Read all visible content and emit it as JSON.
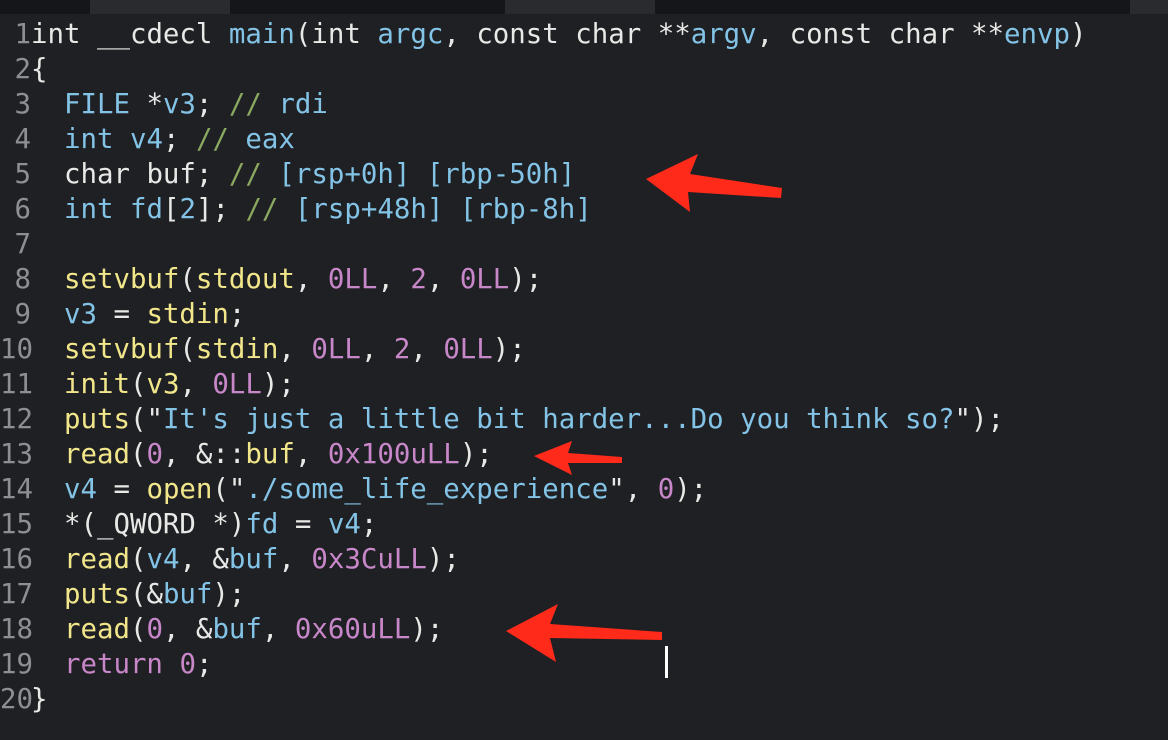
{
  "editor": {
    "lines": [
      {
        "num": "1",
        "tokens": [
          [
            "t-ty",
            "int"
          ],
          [
            "t-kw",
            " __cdecl "
          ],
          [
            "t-id",
            "main"
          ],
          [
            "t-kw",
            "("
          ],
          [
            "t-ty",
            "int"
          ],
          [
            "t-kw",
            " "
          ],
          [
            "t-id",
            "argc"
          ],
          [
            "t-kw",
            ", "
          ],
          [
            "t-ty",
            "const char"
          ],
          [
            "t-kw",
            " **"
          ],
          [
            "t-id",
            "argv"
          ],
          [
            "t-kw",
            ", "
          ],
          [
            "t-ty",
            "const char"
          ],
          [
            "t-kw",
            " **"
          ],
          [
            "t-id",
            "envp"
          ],
          [
            "t-kw",
            ")"
          ]
        ]
      },
      {
        "num": "2",
        "tokens": [
          [
            "t-kw",
            "{"
          ]
        ]
      },
      {
        "num": "3",
        "tokens": [
          [
            "t-kw",
            "  "
          ],
          [
            "t-id",
            "FILE"
          ],
          [
            "t-kw",
            " *"
          ],
          [
            "t-id",
            "v3"
          ],
          [
            "t-kw",
            "; "
          ],
          [
            "t-cm",
            "// "
          ],
          [
            "t-cmtxt",
            "rdi"
          ]
        ]
      },
      {
        "num": "4",
        "tokens": [
          [
            "t-kw",
            "  "
          ],
          [
            "t-id",
            "int"
          ],
          [
            "t-kw",
            " "
          ],
          [
            "t-id",
            "v4"
          ],
          [
            "t-kw",
            "; "
          ],
          [
            "t-cm",
            "// "
          ],
          [
            "t-cmtxt",
            "eax"
          ]
        ]
      },
      {
        "num": "5",
        "tokens": [
          [
            "t-kw",
            "  "
          ],
          [
            "t-kw",
            "char"
          ],
          [
            "t-kw",
            " buf; "
          ],
          [
            "t-cm",
            "// "
          ],
          [
            "t-cmtxt",
            "[rsp+0h] [rbp-50h]"
          ]
        ]
      },
      {
        "num": "6",
        "tokens": [
          [
            "t-kw",
            "  "
          ],
          [
            "t-id",
            "int"
          ],
          [
            "t-kw",
            " "
          ],
          [
            "t-id",
            "fd"
          ],
          [
            "t-kw",
            "["
          ],
          [
            "t-id",
            "2"
          ],
          [
            "t-kw",
            "]; "
          ],
          [
            "t-cm",
            "// "
          ],
          [
            "t-cmtxt",
            "[rsp+48h] [rbp-8h]"
          ]
        ]
      },
      {
        "num": "7",
        "tokens": []
      },
      {
        "num": "8",
        "tokens": [
          [
            "t-kw",
            "  "
          ],
          [
            "t-fn",
            "setvbuf"
          ],
          [
            "t-kw",
            "("
          ],
          [
            "t-fn",
            "stdout"
          ],
          [
            "t-kw",
            ", "
          ],
          [
            "t-num",
            "0LL"
          ],
          [
            "t-kw",
            ", "
          ],
          [
            "t-num",
            "2"
          ],
          [
            "t-kw",
            ", "
          ],
          [
            "t-num",
            "0LL"
          ],
          [
            "t-kw",
            ");"
          ]
        ]
      },
      {
        "num": "9",
        "tokens": [
          [
            "t-kw",
            "  "
          ],
          [
            "t-id",
            "v3"
          ],
          [
            "t-kw",
            " = "
          ],
          [
            "t-fn",
            "stdin"
          ],
          [
            "t-kw",
            ";"
          ]
        ]
      },
      {
        "num": "10",
        "tokens": [
          [
            "t-kw",
            "  "
          ],
          [
            "t-fn",
            "setvbuf"
          ],
          [
            "t-kw",
            "("
          ],
          [
            "t-fn",
            "stdin"
          ],
          [
            "t-kw",
            ", "
          ],
          [
            "t-num",
            "0LL"
          ],
          [
            "t-kw",
            ", "
          ],
          [
            "t-num",
            "2"
          ],
          [
            "t-kw",
            ", "
          ],
          [
            "t-num",
            "0LL"
          ],
          [
            "t-kw",
            ");"
          ]
        ]
      },
      {
        "num": "11",
        "tokens": [
          [
            "t-kw",
            "  "
          ],
          [
            "t-fn",
            "init"
          ],
          [
            "t-kw",
            "("
          ],
          [
            "t-fn",
            "v3"
          ],
          [
            "t-kw",
            ", "
          ],
          [
            "t-num",
            "0LL"
          ],
          [
            "t-kw",
            ");"
          ]
        ]
      },
      {
        "num": "12",
        "tokens": [
          [
            "t-kw",
            "  "
          ],
          [
            "t-fn",
            "puts"
          ],
          [
            "t-kw",
            "(\""
          ],
          [
            "t-str",
            "It's just a little bit harder...Do you think so?"
          ],
          [
            "t-kw",
            "\");"
          ]
        ]
      },
      {
        "num": "13",
        "tokens": [
          [
            "t-kw",
            "  "
          ],
          [
            "t-fn",
            "read"
          ],
          [
            "t-kw",
            "("
          ],
          [
            "t-num",
            "0"
          ],
          [
            "t-kw",
            ", &::"
          ],
          [
            "t-fn",
            "buf"
          ],
          [
            "t-kw",
            ", "
          ],
          [
            "t-num",
            "0x100uLL"
          ],
          [
            "t-kw",
            ");"
          ]
        ]
      },
      {
        "num": "14",
        "tokens": [
          [
            "t-kw",
            "  "
          ],
          [
            "t-id",
            "v4"
          ],
          [
            "t-kw",
            " = "
          ],
          [
            "t-fn",
            "open"
          ],
          [
            "t-kw",
            "(\""
          ],
          [
            "t-str",
            "./some_life_experience"
          ],
          [
            "t-kw",
            "\", "
          ],
          [
            "t-num",
            "0"
          ],
          [
            "t-kw",
            ");"
          ]
        ]
      },
      {
        "num": "15",
        "tokens": [
          [
            "t-kw",
            "  *("
          ],
          [
            "t-kw",
            "_QWORD"
          ],
          [
            "t-kw",
            " *)"
          ],
          [
            "t-id",
            "fd"
          ],
          [
            "t-kw",
            " = "
          ],
          [
            "t-id",
            "v4"
          ],
          [
            "t-kw",
            ";"
          ]
        ]
      },
      {
        "num": "16",
        "tokens": [
          [
            "t-kw",
            "  "
          ],
          [
            "t-fn",
            "read"
          ],
          [
            "t-kw",
            "("
          ],
          [
            "t-id",
            "v4"
          ],
          [
            "t-kw",
            ", &"
          ],
          [
            "t-id",
            "buf"
          ],
          [
            "t-kw",
            ", "
          ],
          [
            "t-num",
            "0x3CuLL"
          ],
          [
            "t-kw",
            ");"
          ]
        ]
      },
      {
        "num": "17",
        "tokens": [
          [
            "t-kw",
            "  "
          ],
          [
            "t-fn",
            "puts"
          ],
          [
            "t-kw",
            "(&"
          ],
          [
            "t-id",
            "buf"
          ],
          [
            "t-kw",
            ");"
          ]
        ]
      },
      {
        "num": "18",
        "tokens": [
          [
            "t-kw",
            "  "
          ],
          [
            "t-fn",
            "read"
          ],
          [
            "t-kw",
            "("
          ],
          [
            "t-num",
            "0"
          ],
          [
            "t-kw",
            ", &"
          ],
          [
            "t-id",
            "buf"
          ],
          [
            "t-kw",
            ", "
          ],
          [
            "t-num",
            "0x60uLL"
          ],
          [
            "t-kw",
            ");"
          ]
        ]
      },
      {
        "num": "19",
        "tokens": [
          [
            "t-kw",
            "  "
          ],
          [
            "t-ret",
            "return"
          ],
          [
            "t-kw",
            " "
          ],
          [
            "t-num",
            "0"
          ],
          [
            "t-kw",
            ";"
          ]
        ]
      },
      {
        "num": "20",
        "tokens": [
          [
            "t-kw",
            "}"
          ]
        ]
      }
    ]
  },
  "colors": {
    "background": "#1f2024",
    "arrow": "#ff2a1a",
    "line_number": "#8e8f93"
  }
}
